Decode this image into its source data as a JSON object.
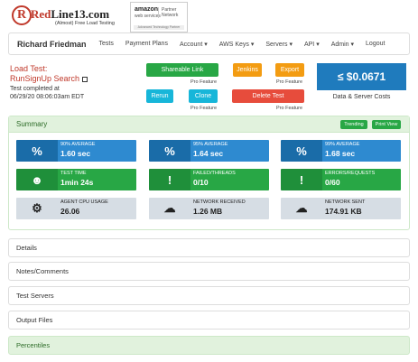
{
  "header": {
    "logo_letter": "R",
    "logo_prefix": "Red",
    "logo_suffix": "Line13.com",
    "logo_tagline": "(Almost) Free Load Testing",
    "amazon_title": "amazon",
    "amazon_sub": "web services",
    "amazon_partner_1": "Partner",
    "amazon_partner_2": "Network",
    "amazon_footer": "Advanced Technology Partner"
  },
  "nav": {
    "user": "Richard Friedman",
    "items": [
      "Tests",
      "Payment Plans",
      "Account ▾",
      "AWS Keys ▾",
      "Servers ▾",
      "API ▾",
      "Admin ▾",
      "Logout"
    ]
  },
  "load_test": {
    "title_line1": "Load Test:",
    "title_line2": "RunSignUp Search",
    "completed_label": "Test completed at",
    "completed_time": "06/29/20 08:06:03am EDT"
  },
  "actions": {
    "shareable_link": "Shareable Link",
    "jenkins": "Jenkins",
    "export": "Export",
    "rerun": "Rerun",
    "clone": "Clone",
    "delete_test": "Delete Test",
    "pro_feature": "Pro Feature"
  },
  "cost": {
    "value": "≤ $0.0671",
    "label": "Data & Server Costs"
  },
  "summary": {
    "title": "Summary",
    "trending": "Trending",
    "print_view": "Print View",
    "tiles": [
      {
        "icon": "percent-icon",
        "glyph": "%",
        "label": "90% AVERAGE",
        "value": "1.60 sec"
      },
      {
        "icon": "percent-icon",
        "glyph": "%",
        "label": "95% AVERAGE",
        "value": "1.64 sec"
      },
      {
        "icon": "percent-icon",
        "glyph": "%",
        "label": "99% AVERAGE",
        "value": "1.68 sec"
      },
      {
        "icon": "user-icon",
        "glyph": "☻",
        "label": "TEST TIME",
        "value": "1min 24s"
      },
      {
        "icon": "alert-icon",
        "glyph": "!",
        "label": "FAILED/THREADS",
        "value": "0/10"
      },
      {
        "icon": "alert-icon",
        "glyph": "!",
        "label": "ERRORS/REQUESTS",
        "value": "0/60"
      },
      {
        "icon": "gears-icon",
        "glyph": "⚙",
        "label": "AGENT CPU USAGE",
        "value": "26.06"
      },
      {
        "icon": "cloud-download-icon",
        "glyph": "☁",
        "label": "NETWORK RECEIVED",
        "value": "1.26 MB"
      },
      {
        "icon": "cloud-upload-icon",
        "glyph": "☁",
        "label": "NETWORK SENT",
        "value": "174.91 KB"
      }
    ]
  },
  "panels": [
    "Details",
    "Notes/Comments",
    "Test Servers",
    "Output Files",
    "Percentiles"
  ],
  "colors": {
    "accent_red": "#c0392b",
    "green": "#28a745",
    "blue": "#2e8ad0",
    "orange": "#f39c12",
    "cyan": "#17b6d9",
    "danger": "#e74c3c"
  }
}
